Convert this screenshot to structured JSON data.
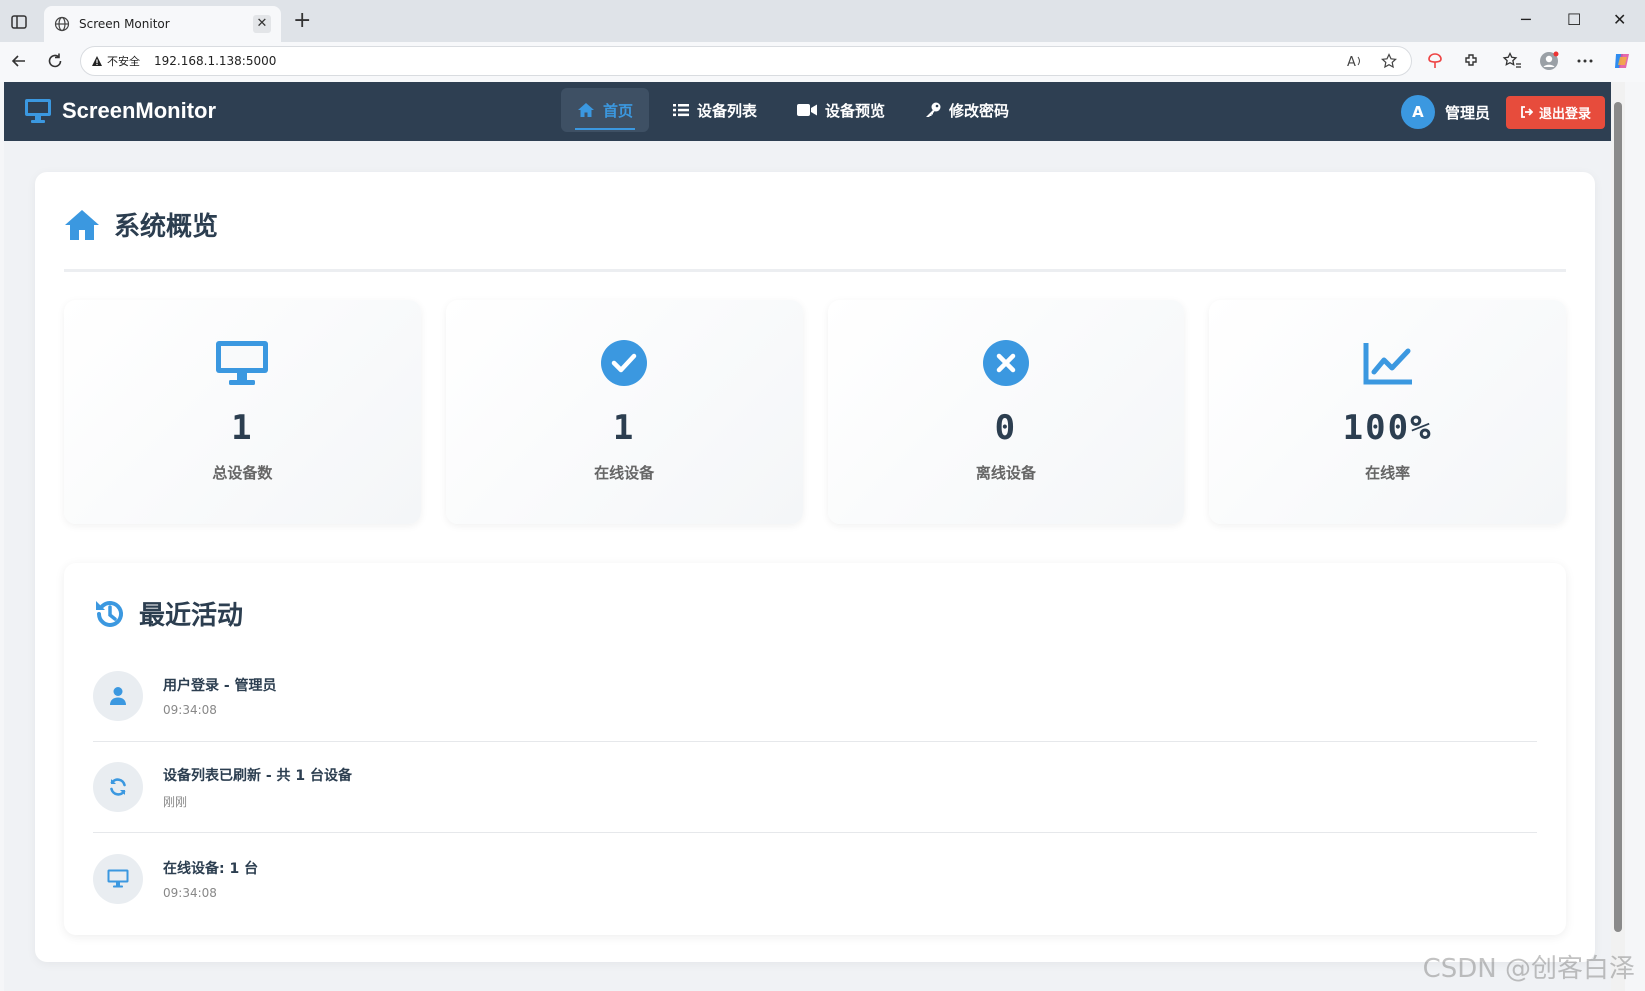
{
  "browser": {
    "tab_title": "Screen Monitor",
    "tab_close": "✕",
    "new_tab": "+",
    "security_label": "不安全",
    "url": "192.168.1.138:5000",
    "win_min": "─",
    "win_max": "☐",
    "win_close": "✕"
  },
  "navbar": {
    "brand": "ScreenMonitor",
    "links": [
      {
        "label": "首页",
        "icon": "home-icon",
        "active": true
      },
      {
        "label": "设备列表",
        "icon": "list-icon"
      },
      {
        "label": "设备预览",
        "icon": "video-icon"
      },
      {
        "label": "修改密码",
        "icon": "key-icon"
      }
    ],
    "avatar_letter": "A",
    "user_name": "管理员",
    "logout_label": "退出登录"
  },
  "overview": {
    "title": "系统概览",
    "stats": [
      {
        "value": "1",
        "label": "总设备数",
        "icon": "desktop-icon"
      },
      {
        "value": "1",
        "label": "在线设备",
        "icon": "check-circle-icon"
      },
      {
        "value": "0",
        "label": "离线设备",
        "icon": "x-circle-icon"
      },
      {
        "value": "100%",
        "label": "在线率",
        "icon": "line-chart-icon"
      }
    ]
  },
  "activity": {
    "title": "最近活动",
    "items": [
      {
        "text": "用户登录 - 管理员",
        "time": "09:34:08",
        "icon": "user-icon"
      },
      {
        "text": "设备列表已刷新 - 共 1 台设备",
        "time": "刚刚",
        "icon": "refresh-icon"
      },
      {
        "text": "在线设备: 1 台",
        "time": "09:34:08",
        "icon": "desktop-icon"
      }
    ]
  },
  "watermark": "CSDN @创客白泽",
  "colors": {
    "accent": "#3b98e0",
    "navbar": "#2e3f52",
    "danger": "#e74c3c"
  }
}
